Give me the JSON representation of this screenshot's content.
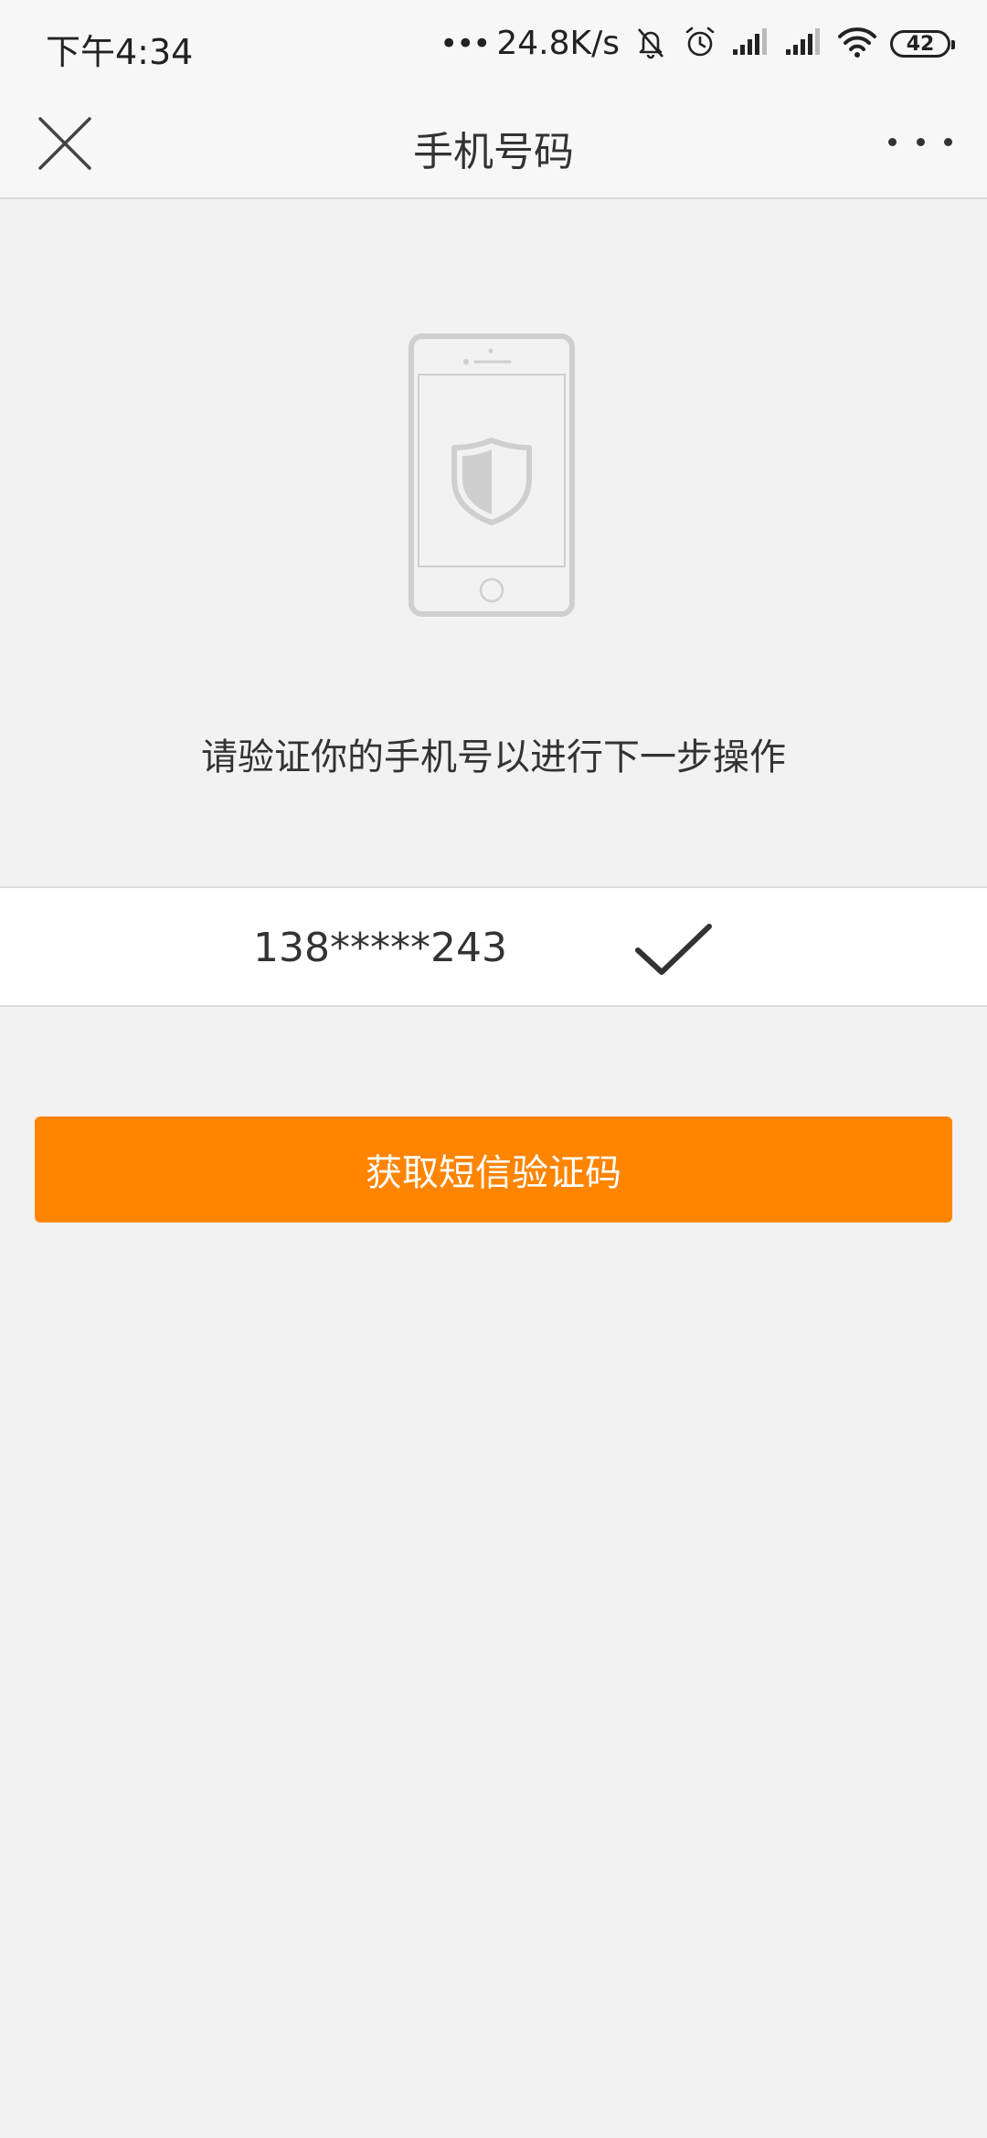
{
  "status_bar": {
    "time": "下午4:34",
    "dots": "•••",
    "network_speed": "24.8K/s",
    "battery_level": "42",
    "icons": [
      "mute-bell-icon",
      "alarm-icon",
      "signal-icon",
      "signal-icon",
      "wifi-icon",
      "battery-icon"
    ]
  },
  "nav": {
    "title": "手机号码",
    "close_icon": "close-icon",
    "more_icon": "more-icon"
  },
  "main": {
    "illustration_icon": "phone-shield-icon",
    "instruction": "请验证你的手机号以进行下一步操作",
    "phone_number": "138*****243",
    "check_icon": "checkmark-icon",
    "sms_button_label": "获取短信验证码"
  },
  "colors": {
    "accent": "#ff8400",
    "background": "#f2f2f2"
  }
}
